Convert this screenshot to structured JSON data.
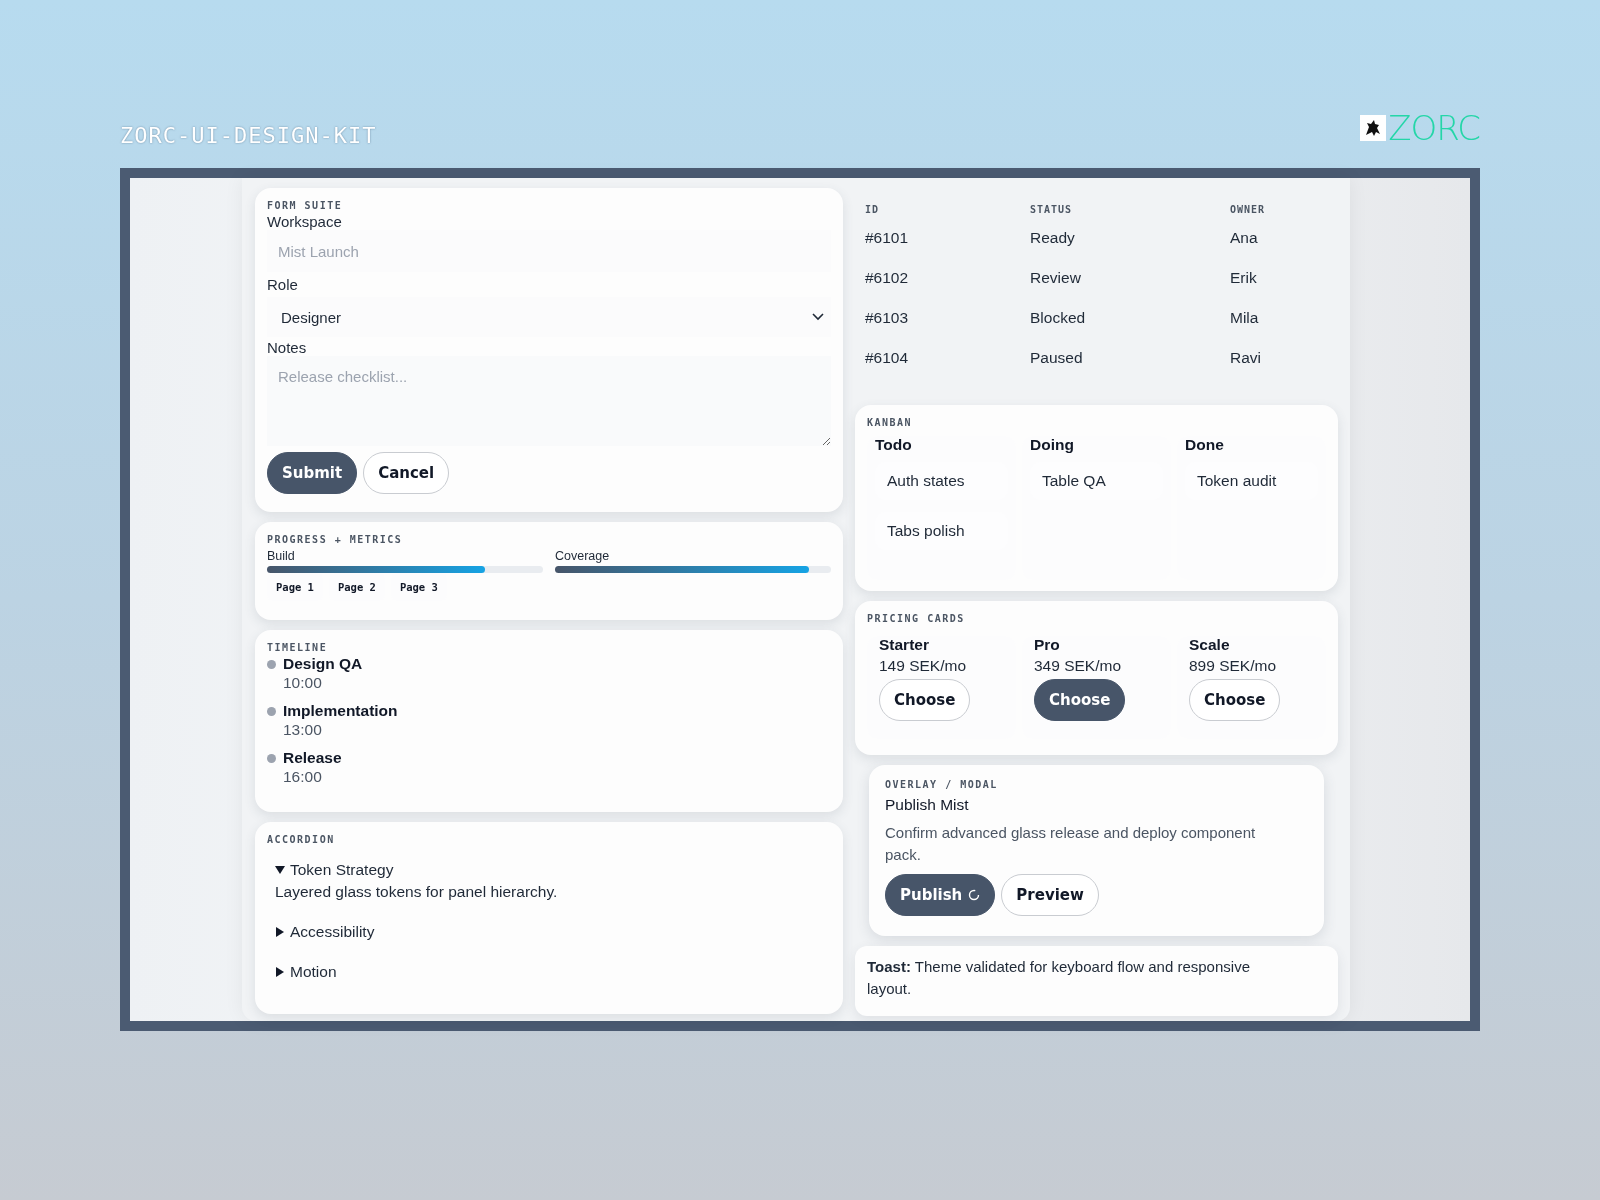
{
  "header": {
    "title": "ZORC-UI-DESIGN-KIT",
    "logo_text": "ZORC"
  },
  "form": {
    "section": "FORM SUITE",
    "workspace_label": "Workspace",
    "workspace_placeholder": "Mist Launch",
    "role_label": "Role",
    "role_value": "Designer",
    "notes_label": "Notes",
    "notes_placeholder": "Release checklist...",
    "buttons": [
      {
        "label": "Submit",
        "kind": "primary"
      },
      {
        "label": "Cancel",
        "kind": "secondary"
      }
    ]
  },
  "progress": {
    "section": "PROGRESS + METRICS",
    "meters": [
      {
        "name": "Build",
        "level": 0.79
      },
      {
        "name": "Coverage",
        "level": 0.92
      }
    ],
    "pages": [
      {
        "label": "Page 1",
        "selected": false
      },
      {
        "label": "Page 2",
        "selected": false
      },
      {
        "label": "Page 3",
        "selected": false
      }
    ]
  },
  "timeline": {
    "section": "TIMELINE",
    "events": [
      {
        "title": "Design QA",
        "time": "10:00"
      },
      {
        "title": "Implementation",
        "time": "13:00"
      },
      {
        "title": "Release",
        "time": "16:00"
      }
    ]
  },
  "accordion": {
    "section": "ACCORDION",
    "items": [
      {
        "title": "Token Strategy",
        "expanded": true,
        "body": "Layered glass tokens for panel hierarchy."
      },
      {
        "title": "Accessibility",
        "expanded": false
      },
      {
        "title": "Motion",
        "expanded": false
      }
    ]
  },
  "table": {
    "columns": [
      "ID",
      "STATUS",
      "OWNER"
    ],
    "rows": [
      [
        "#6101",
        "Ready",
        "Ana"
      ],
      [
        "#6102",
        "Review",
        "Erik"
      ],
      [
        "#6103",
        "Blocked",
        "Mila"
      ],
      [
        "#6104",
        "Paused",
        "Ravi"
      ]
    ]
  },
  "kanban": {
    "section": "KANBAN",
    "columns": [
      {
        "title": "Todo",
        "cards": [
          "Auth states",
          "Tabs polish"
        ]
      },
      {
        "title": "Doing",
        "cards": [
          "Table QA"
        ]
      },
      {
        "title": "Done",
        "cards": [
          "Token audit"
        ]
      }
    ]
  },
  "pricing": {
    "section": "PRICING CARDS",
    "plans": [
      {
        "name": "Starter",
        "price": "149 SEK/mo",
        "button": "Choose",
        "selected": false
      },
      {
        "name": "Pro",
        "price": "349 SEK/mo",
        "button": "Choose",
        "selected": true
      },
      {
        "name": "Scale",
        "price": "899 SEK/mo",
        "button": "Choose",
        "selected": false
      }
    ]
  },
  "modal": {
    "section": "OVERLAY / MODAL",
    "title": "Publish Mist",
    "text": "Confirm advanced glass release and deploy component pack.",
    "buttons": [
      {
        "label": "Publish",
        "kind": "primary",
        "loading": true
      },
      {
        "label": "Preview",
        "kind": "secondary",
        "loading": false
      }
    ]
  },
  "toast": {
    "text": "**Toast:** Theme validated for keyboard flow and responsive layout."
  }
}
